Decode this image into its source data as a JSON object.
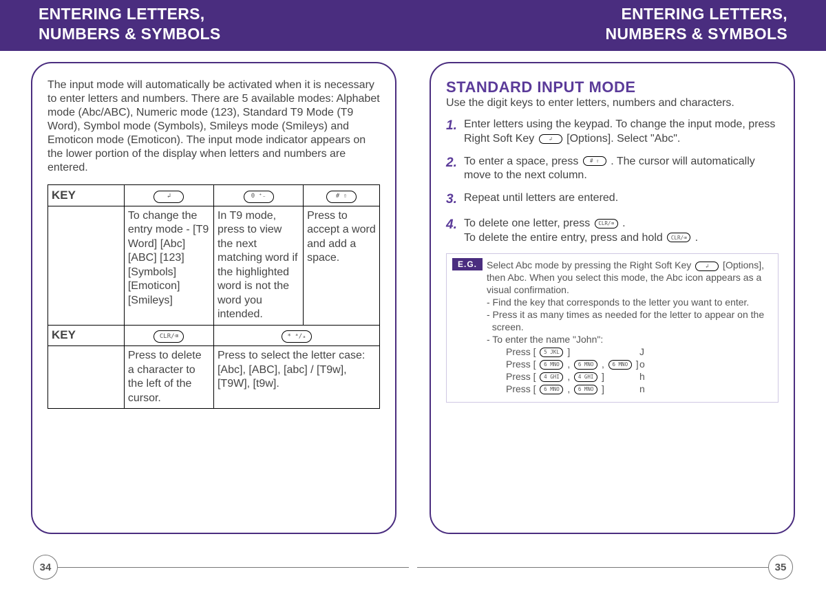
{
  "header": {
    "leftTitle1": "ENTERING LETTERS,",
    "leftTitle2": "NUMBERS & SYMBOLS",
    "rightTitle1": "ENTERING LETTERS,",
    "rightTitle2": "NUMBERS & SYMBOLS"
  },
  "leftPage": {
    "intro": "The input mode will automatically be activated when it is necessary to enter letters and numbers. There are 5 available modes: Alphabet mode (Abc/ABC), Numeric mode (123), Standard T9 Mode (T9 Word), Symbol mode (Symbols), Smileys mode (Smileys) and Emoticon mode (Emoticon). The input mode indicator appears on the lower portion of the display when letters and numbers are entered.",
    "keyLabel": "KEY",
    "table1": {
      "col1Glyph": "↲",
      "col2Glyph": "0 ⁺₋",
      "col3Glyph": "# ⇧",
      "row1": "To change the entry mode - [T9 Word] [Abc] [ABC] [123] [Symbols] [Emoticon] [Smileys]",
      "row2": "In T9 mode, press to view the next matching word if the highlighted word is not the word you intended.",
      "row3": "Press to accept a word and add a space."
    },
    "table2": {
      "col1Glyph": "CLR/⌫",
      "col2Glyph": "* ᵃ/ₐ",
      "row1": "Press to delete a character to the left of the cursor.",
      "row2": "Press to select the letter case: [Abc], [ABC], [abc] / [T9w], [T9W], [t9w]."
    },
    "pageNumber": "34"
  },
  "rightPage": {
    "heading": "STANDARD INPUT MODE",
    "sub": "Use the digit keys to enter letters, numbers and characters.",
    "steps": [
      {
        "num": "1.",
        "textA": "Enter letters using the keypad. To change the input mode, press Right Soft Key ",
        "key": "↲",
        "textB": " [Options]. Select \"Abc\"."
      },
      {
        "num": "2.",
        "textA": "To enter a space, press ",
        "key": "# ⇧",
        "textB": " . The cursor will automatically move to the next column."
      },
      {
        "num": "3.",
        "textA": "Repeat until letters are entered.",
        "key": "",
        "textB": ""
      },
      {
        "num": "4.",
        "textA": "To delete one letter, press ",
        "key": "CLR/⌫",
        "textB": " .",
        "line2A": "   To delete the entire entry, press and hold ",
        "line2Key": "CLR/⌫",
        "line2B": " ."
      }
    ],
    "eg": {
      "tag": "E.G.",
      "p1a": "Select Abc mode by pressing the Right Soft Key ",
      "p1key": "↲",
      "p1b": " [Options], then Abc. When you select this mode, the Abc icon appears as a visual confirmation.",
      "b1": "- Find the key that corresponds to the letter you want to enter.",
      "b2": "- Press it as many times as needed for the letter to appear on the",
      "b2b": "  screen.",
      "b3": "- To enter the name \"John\":",
      "lines": [
        {
          "leftA": "Press [ ",
          "keys": [
            "5 JKL"
          ],
          "leftB": " ]",
          "right": "J"
        },
        {
          "leftA": "Press [ ",
          "keys": [
            "6 MNO",
            "6 MNO",
            "6 MNO"
          ],
          "leftB": " ]",
          "right": "o"
        },
        {
          "leftA": "Press [ ",
          "keys": [
            "4 GHI",
            "4 GHI"
          ],
          "leftB": " ]",
          "right": "h"
        },
        {
          "leftA": "Press [ ",
          "keys": [
            "6 MNO",
            "6 MNO"
          ],
          "leftB": " ]",
          "right": "n"
        }
      ]
    },
    "pageNumber": "35"
  }
}
